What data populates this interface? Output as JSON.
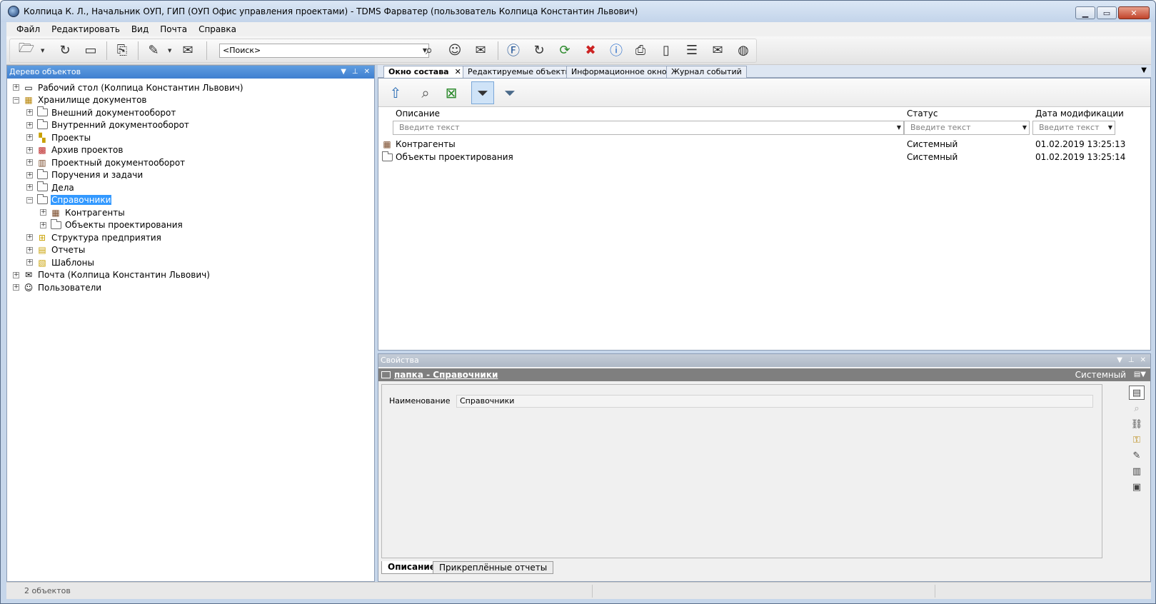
{
  "window": {
    "title": "Колпица К. Л., Начальник ОУП, ГИП (ОУП Офис управления проектами) - TDMS Фарватер (пользователь Колпица Константин Львович)",
    "controls": {
      "minimize": "▁",
      "maximize": "▭",
      "close": "✕"
    }
  },
  "menu": [
    "Файл",
    "Редактировать",
    "Вид",
    "Почта",
    "Справка"
  ],
  "toolbar": {
    "search_placeholder": "<Поиск>",
    "icons": [
      "new-object-icon",
      "refresh-icon",
      "window-icon",
      "copy-icon",
      "mail-edit-icon",
      "mail-icon",
      "search-icon",
      "user-search-icon",
      "mail-search-icon",
      "help-icon",
      "refresh-icon",
      "sync-icon",
      "cancel-icon",
      "info-icon",
      "bookmark-icon",
      "document-icon",
      "message-icon",
      "envelope-icon",
      "globe-icon"
    ]
  },
  "left_panel": {
    "title": "Дерево объектов",
    "tree": [
      {
        "label": "Рабочий стол (Колпица Константин Львович)",
        "level": 0,
        "expander": "+",
        "icon": "desktop-icon"
      },
      {
        "label": "Хранилище документов",
        "level": 0,
        "expander": "−",
        "icon": "storage-icon"
      },
      {
        "label": "Внешний документооборот",
        "level": 1,
        "expander": "+",
        "icon": "folder-icon"
      },
      {
        "label": "Внутренний документооборот",
        "level": 1,
        "expander": "+",
        "icon": "folder-icon"
      },
      {
        "label": "Проекты",
        "level": 1,
        "expander": "+",
        "icon": "projects-icon"
      },
      {
        "label": "Архив проектов",
        "level": 1,
        "expander": "+",
        "icon": "archive-icon"
      },
      {
        "label": "Проектный документооборот",
        "level": 1,
        "expander": "+",
        "icon": "books-icon"
      },
      {
        "label": "Поручения и задачи",
        "level": 1,
        "expander": "+",
        "icon": "folder-icon"
      },
      {
        "label": "Дела",
        "level": 1,
        "expander": "+",
        "icon": "folder-icon"
      },
      {
        "label": "Справочники",
        "level": 1,
        "expander": "−",
        "icon": "folder-icon",
        "selected": true
      },
      {
        "label": "Контрагенты",
        "level": 2,
        "expander": "+",
        "icon": "building-icon"
      },
      {
        "label": "Объекты проектирования",
        "level": 2,
        "expander": "+",
        "icon": "folder-icon"
      },
      {
        "label": "Структура предприятия",
        "level": 1,
        "expander": "+",
        "icon": "org-structure-icon"
      },
      {
        "label": "Отчеты",
        "level": 1,
        "expander": "+",
        "icon": "reports-icon"
      },
      {
        "label": "Шаблоны",
        "level": 1,
        "expander": "+",
        "icon": "templates-icon"
      },
      {
        "label": "Почта (Колпица Константин Львович)",
        "level": 0,
        "expander": "+",
        "icon": "mail-icon"
      },
      {
        "label": "Пользователи",
        "level": 0,
        "expander": "+",
        "icon": "user-icon"
      }
    ]
  },
  "tabs": [
    {
      "label": "Окно состава",
      "active": true,
      "close": "✕"
    },
    {
      "label": "Редактируемые объекты"
    },
    {
      "label": "Информационное окно"
    },
    {
      "label": "Журнал событий"
    }
  ],
  "composition": {
    "columns": [
      "Описание",
      "Статус",
      "Дата модификации"
    ],
    "filter_placeholder": "Введите текст",
    "rows": [
      {
        "description": "Контрагенты",
        "status": "Системный",
        "date": "01.02.2019 13:25:13",
        "icon": "building-icon"
      },
      {
        "description": "Объекты проектирования",
        "status": "Системный",
        "date": "01.02.2019 13:25:14",
        "icon": "folder-icon"
      }
    ]
  },
  "properties": {
    "title": "Свойства",
    "object_title": "папка - Справочники",
    "object_status": "Системный",
    "field_label": "Наименование",
    "field_value": "Справочники",
    "bottom_tabs": [
      {
        "label": "Описание",
        "active": true
      },
      {
        "label": "Прикреплённые отчеты"
      }
    ]
  },
  "status": {
    "text": "2 объектов"
  }
}
